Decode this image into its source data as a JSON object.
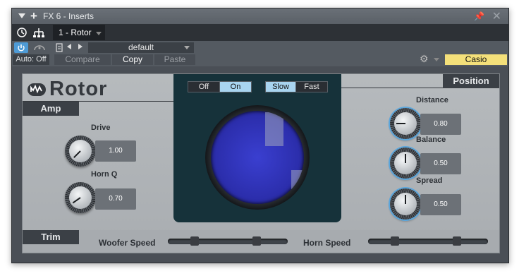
{
  "window": {
    "title": "FX 6 - Inserts"
  },
  "preset_bar": {
    "slot_name": "1 - Rotor",
    "preset": "default"
  },
  "toolbar": {
    "auto_label": "Auto: Off",
    "compare_label": "Compare",
    "copy_label": "Copy",
    "paste_label": "Paste",
    "device_name": "Casio",
    "device_color": "#f4e07a"
  },
  "plugin": {
    "name": "Rotor",
    "sections": {
      "amp": "Amp",
      "position": "Position",
      "trim": "Trim"
    },
    "amp_controls": [
      {
        "label": "Drive",
        "value": "1.00"
      },
      {
        "label": "Horn Q",
        "value": "0.70"
      }
    ],
    "position_controls": [
      {
        "label": "Distance",
        "value": "0.80"
      },
      {
        "label": "Balance",
        "value": "0.50"
      },
      {
        "label": "Spread",
        "value": "0.50"
      }
    ],
    "rotor_switch": {
      "off": "Off",
      "on": "On",
      "active": "On"
    },
    "speed_switch": {
      "slow": "Slow",
      "fast": "Fast",
      "active": "Slow"
    },
    "trim": {
      "woofer_label": "Woofer Speed",
      "horn_label": "Horn Speed"
    },
    "accent_color": "#a8d4f0"
  }
}
